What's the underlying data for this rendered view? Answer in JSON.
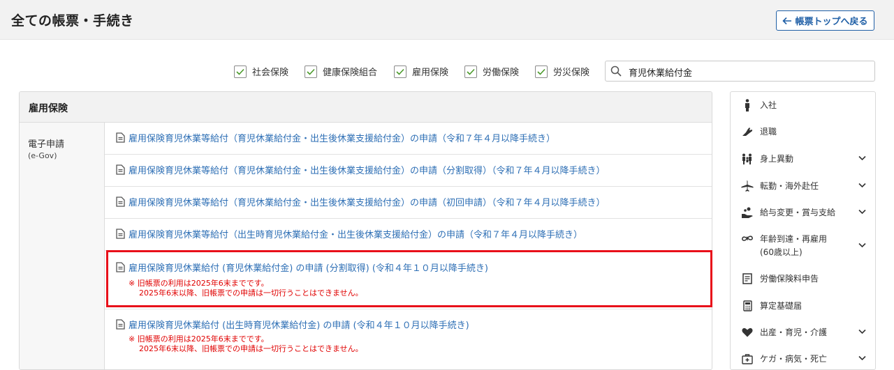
{
  "header": {
    "title": "全ての帳票・手続き",
    "back_label": "帳票トップへ戻る"
  },
  "filters": [
    {
      "label": "社会保険",
      "checked": true
    },
    {
      "label": "健康保険組合",
      "checked": true
    },
    {
      "label": "雇用保険",
      "checked": true
    },
    {
      "label": "労働保険",
      "checked": true
    },
    {
      "label": "労災保険",
      "checked": true
    }
  ],
  "search": {
    "value": "育児休業給付金"
  },
  "panel": {
    "title": "雇用保険",
    "category": "電子申請",
    "category_sub": "(e-Gov)",
    "rows": [
      {
        "label": "雇用保険育児休業等給付（育児休業給付金・出生後休業支援給付金）の申請（令和７年４月以降手続き）"
      },
      {
        "label": "雇用保険育児休業等給付（育児休業給付金・出生後休業支援給付金）の申請（分割取得）（令和７年４月以降手続き）"
      },
      {
        "label": "雇用保険育児休業等給付（育児休業給付金・出生後休業支援給付金）の申請（初回申請）（令和７年４月以降手続き）"
      },
      {
        "label": "雇用保険育児休業等給付（出生時育児休業給付金・出生後休業支援給付金）の申請（令和７年４月以降手続き）"
      },
      {
        "label": "雇用保険育児休業給付 (育児休業給付金) の申請 (分割取得) (令和４年１０月以降手続き)",
        "warn1": "※ 旧帳票の利用は2025年6末までです。",
        "warn2": "2025年6末以降、旧帳票での申請は一切行うことはできません。"
      },
      {
        "label": "雇用保険育児休業給付 (出生時育児休業給付金) の申請 (令和４年１０月以降手続き)",
        "warn1": "※ 旧帳票の利用は2025年6末までです。",
        "warn2": "2025年6末以降、旧帳票での申請は一切行うことはできません。"
      }
    ]
  },
  "sidebar": {
    "items": [
      {
        "label": "入社",
        "icon": "person-icon",
        "expandable": false
      },
      {
        "label": "退職",
        "icon": "wave-hand-icon",
        "expandable": false
      },
      {
        "label": "身上異動",
        "icon": "family-icon",
        "expandable": true
      },
      {
        "label": "転勤・海外赴任",
        "icon": "airplane-icon",
        "expandable": true
      },
      {
        "label": "給与変更・賞与支給",
        "icon": "money-hand-icon",
        "expandable": true
      },
      {
        "label": "年齢到達・再雇用",
        "label2": "(60歳以上)",
        "icon": "infinity-icon",
        "expandable": true
      },
      {
        "label": "労働保険料申告",
        "icon": "document-icon",
        "expandable": false
      },
      {
        "label": "算定基礎届",
        "icon": "calculator-icon",
        "expandable": false
      },
      {
        "label": "出産・育児・介護",
        "icon": "heart-icon",
        "expandable": true
      },
      {
        "label": "ケガ・病気・死亡",
        "icon": "medical-kit-icon",
        "expandable": true
      }
    ]
  },
  "colors": {
    "link": "#2e6fb5",
    "warning": "#e00000",
    "highlight_border": "#e8101a",
    "accent": "#1f5fa6"
  }
}
